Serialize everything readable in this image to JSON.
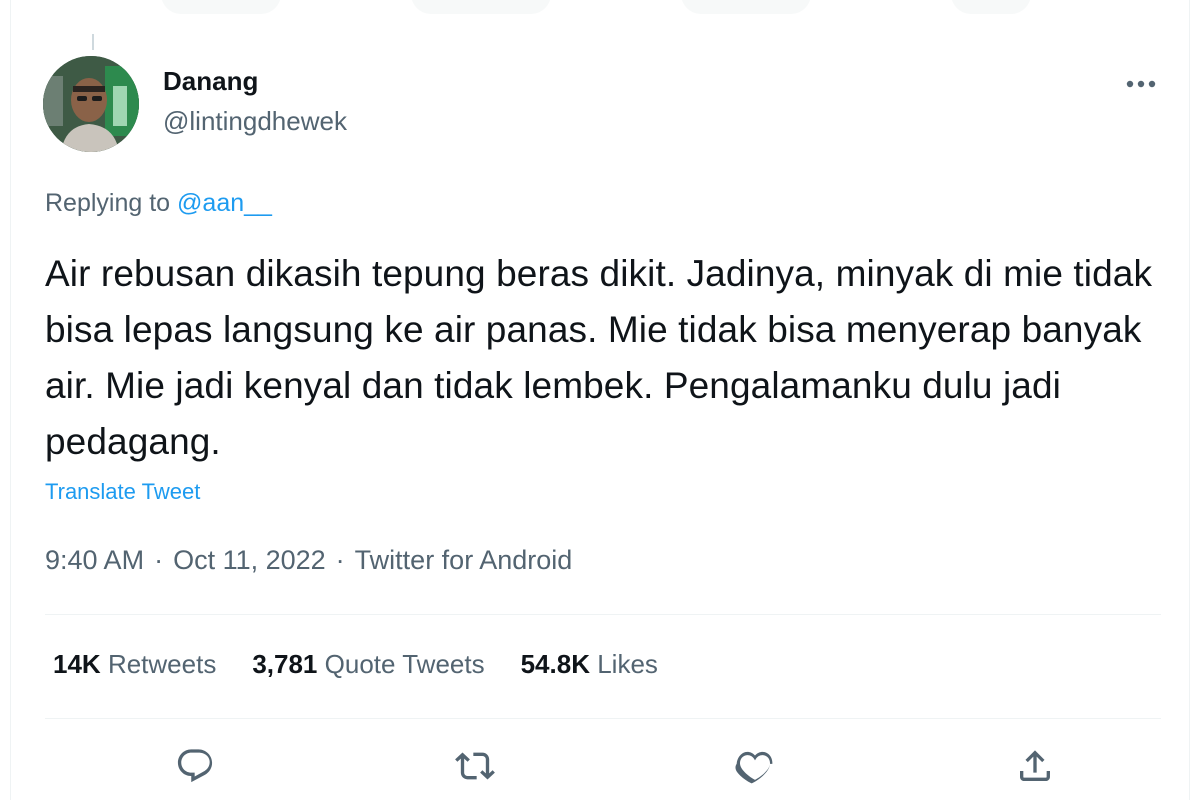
{
  "tweet": {
    "author": {
      "display_name": "Danang",
      "handle": "@lintingdhewek"
    },
    "replying_prefix": "Replying to",
    "replying_to": "@aan__",
    "text": "Air rebusan dikasih tepung beras dikit. Jadinya, minyak di mie tidak bisa lepas langsung ke air panas. Mie tidak bisa menyerap banyak air. Mie jadi kenyal dan tidak lembek. Pengalamanku dulu jadi pedagang.",
    "translate_label": "Translate Tweet",
    "time": "9:40 AM",
    "date": "Oct 11, 2022",
    "source": "Twitter for Android",
    "separator": "·",
    "stats": {
      "retweets_count": "14K",
      "retweets_label": "Retweets",
      "quotes_count": "3,781",
      "quotes_label": "Quote Tweets",
      "likes_count": "54.8K",
      "likes_label": "Likes"
    }
  },
  "icons": {
    "more": "more-horizontal-icon",
    "reply": "reply-icon",
    "retweet": "retweet-icon",
    "like": "heart-icon",
    "share": "share-icon"
  },
  "colors": {
    "text_primary": "#0f1419",
    "text_secondary": "#536471",
    "accent": "#1d9bf0",
    "divider": "#eff3f4"
  }
}
